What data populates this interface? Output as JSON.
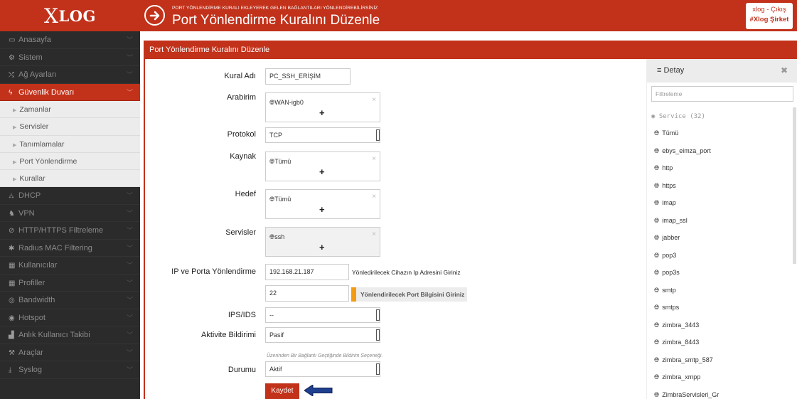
{
  "header": {
    "logo_x": "X",
    "logo_rest": "LOG",
    "subtitle": "PORT YÖNLENDİRME KURALI EKLEYEREK GELEN BAĞLANTILARI YÖNLENDİREBİLİRSİNİZ",
    "title": "Port Yönlendirme Kuralını Düzenle",
    "user": "xlog",
    "user_sep": " - ",
    "logout": "Çıkış",
    "org": "#Xlog Şirket"
  },
  "sidebar": {
    "items": [
      {
        "icon": "▭",
        "label": "Anasayfa"
      },
      {
        "icon": "⚙",
        "label": "Sistem"
      },
      {
        "icon": "⤭",
        "label": "Ağ Ayarları"
      },
      {
        "icon": "ϟ",
        "label": "Güvenlik Duvarı"
      },
      {
        "icon": "⛼",
        "label": "DHCP"
      },
      {
        "icon": "♞",
        "label": "VPN"
      },
      {
        "icon": "⊘",
        "label": "HTTP/HTTPS Filtreleme"
      },
      {
        "icon": "✱",
        "label": "Radius MAC Filtering"
      },
      {
        "icon": "▦",
        "label": "Kullanıcılar"
      },
      {
        "icon": "▦",
        "label": "Profiller"
      },
      {
        "icon": "◎",
        "label": "Bandwidth"
      },
      {
        "icon": "◉",
        "label": "Hotspot"
      },
      {
        "icon": "▟",
        "label": "Anlık Kullanıcı Takibi"
      },
      {
        "icon": "⚒",
        "label": "Araçlar"
      },
      {
        "icon": "⤓",
        "label": "Syslog"
      }
    ],
    "subitems": [
      "Zamanlar",
      "Servisler",
      "Tanımlamalar",
      "Port Yönlendirme",
      "Kurallar"
    ]
  },
  "form": {
    "panel_title": "Port Yönlendirme Kuralını Düzenle",
    "labels": {
      "rule_name": "Kural Adı",
      "interface": "Arabirim",
      "protocol": "Protokol",
      "source": "Kaynak",
      "destination": "Hedef",
      "services": "Servisler",
      "ip_port": "IP ve Porta Yönlendirme",
      "ips": "IPS/IDS",
      "notify": "Aktivite Bildirimi",
      "status": "Durumu"
    },
    "rule_name": "PC_SSH_ERİŞİM",
    "interface_tag": "WAN-igb0",
    "protocol": "TCP",
    "source_tag": "Tümü",
    "destination_tag": "Tümü",
    "service_tag": "ssh",
    "ip": "192.168.21.187",
    "ip_hint": "Yönledirilecek Cihazın Ip Adresini Giriniz",
    "port": "22",
    "port_hint": "Yönlendirilecek Port Bilgisini Giriniz",
    "ips": "--",
    "notify": "Pasif",
    "notify_hint": "Üzerinden Bir Bağlantı Geçtiğinde Bildirim Seçeneği.",
    "status": "Aktif",
    "save": "Kaydet",
    "plus": "+",
    "remove": "×"
  },
  "detail": {
    "title": "Detay",
    "close": "✖",
    "filter_placeholder": "Filtreleme",
    "service_header": "Service (32)",
    "services": [
      "Tümü",
      "ebys_eimza_port",
      "http",
      "https",
      "imap",
      "imap_ssl",
      "jabber",
      "pop3",
      "pop3s",
      "smtp",
      "smtps",
      "zimbra_3443",
      "zimbra_8443",
      "zimbra_smtp_587",
      "zimbra_xmpp",
      "ZimbraServisleri_Gr"
    ]
  },
  "colors": {
    "accent": "#c2311a",
    "sidebar": "#2b2b2b",
    "hint_orange": "#f39c12",
    "arrow": "#1f3f8f"
  }
}
